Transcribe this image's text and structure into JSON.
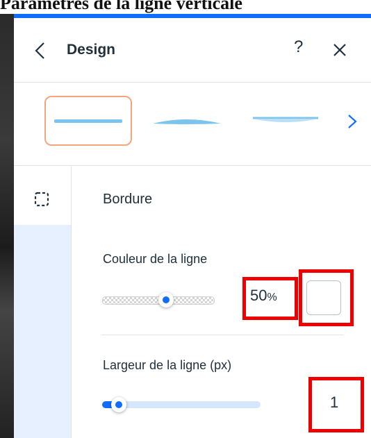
{
  "caption": "Paramètres de la ligne verticale",
  "panel": {
    "title": "Design"
  },
  "presets": [
    {
      "name": "preset-1",
      "selected": true
    },
    {
      "name": "preset-2",
      "selected": false
    },
    {
      "name": "preset-3",
      "selected": false
    }
  ],
  "sections": {
    "border_title": "Bordure",
    "line_color_label": "Couleur de la ligne",
    "line_opacity_value": "50",
    "line_opacity_unit": "%",
    "line_opacity_fraction": 0.5,
    "line_color": "#ffffff",
    "line_width_label": "Largeur de la ligne (px)",
    "line_width_value": "1"
  },
  "icons": {
    "back": "chevron-left-icon",
    "help": "help-icon",
    "close": "close-icon",
    "next": "chevron-right-icon",
    "border": "border-icon"
  },
  "colors": {
    "accent": "#116dff",
    "selected_outline": "#f5a57b",
    "highlight": "#ee0000"
  }
}
